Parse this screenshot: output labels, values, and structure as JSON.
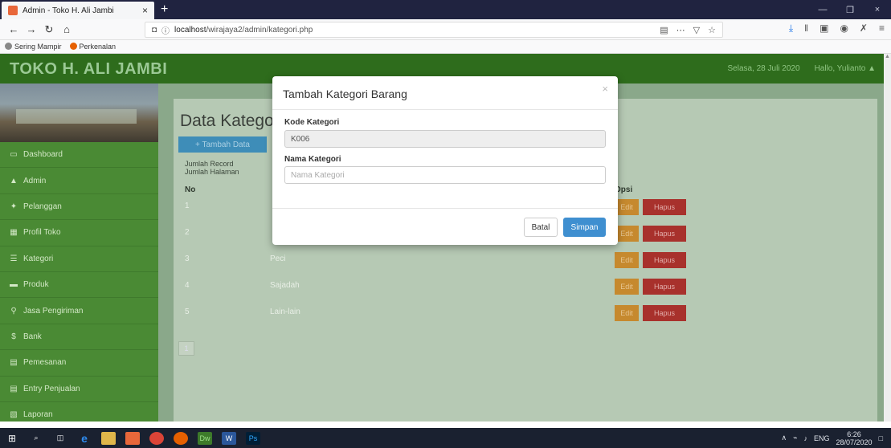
{
  "browser": {
    "tab_title": "Admin - Toko H. Ali Jambi",
    "tab_close": "×",
    "new_tab": "+",
    "url_prefix": "localhost",
    "url_path": "/wirajaya2/admin/kategori.php",
    "bookmarks": [
      "Sering Mampir",
      "Perkenalan"
    ],
    "window_controls": [
      "—",
      "❐",
      "×"
    ]
  },
  "header": {
    "brand": "TOKO H. ALI JAMBI",
    "date": "Selasa, 28 Juli 2020",
    "greeting": "Hallo, Yulianto"
  },
  "sidebar": {
    "items": [
      {
        "label": "Dashboard",
        "icon": "▭"
      },
      {
        "label": "Admin",
        "icon": "▲"
      },
      {
        "label": "Pelanggan",
        "icon": "✦"
      },
      {
        "label": "Profil Toko",
        "icon": "▦"
      },
      {
        "label": "Kategori",
        "icon": "☰"
      },
      {
        "label": "Produk",
        "icon": "▬"
      },
      {
        "label": "Jasa Pengiriman",
        "icon": "⚲"
      },
      {
        "label": "Bank",
        "icon": "$"
      },
      {
        "label": "Pemesanan",
        "icon": "▤"
      },
      {
        "label": "Entry Penjualan",
        "icon": "▤"
      },
      {
        "label": "Laporan",
        "icon": "▧"
      }
    ]
  },
  "content": {
    "title": "Data Kategori",
    "add_button": "+ Tambah Data",
    "jumlah_record": "Jumlah Record",
    "jumlah_halaman": "Jumlah Halaman",
    "col_no": "No",
    "col_opsi": "Opsi",
    "rows": [
      {
        "no": "1",
        "name": ""
      },
      {
        "no": "2",
        "name": ""
      },
      {
        "no": "3",
        "name": "Peci"
      },
      {
        "no": "4",
        "name": "Sajadah"
      },
      {
        "no": "5",
        "name": "Lain-lain"
      }
    ],
    "edit_label": "Edit",
    "hapus_label": "Hapus",
    "page": "1"
  },
  "modal": {
    "title": "Tambah Kategori Barang",
    "close": "×",
    "kode_label": "Kode Kategori",
    "kode_value": "K006",
    "nama_label": "Nama Kategori",
    "nama_placeholder": "Nama Kategori",
    "batal": "Batal",
    "simpan": "Simpan"
  },
  "taskbar": {
    "lang": "ENG",
    "time": "6:26",
    "date": "28/07/2020"
  }
}
